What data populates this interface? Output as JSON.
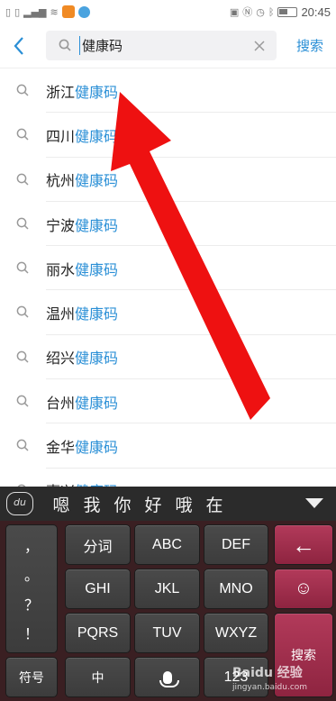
{
  "status_bar": {
    "time": "20:45",
    "left_icons": [
      "sim-icon",
      "sim-icon",
      "signal-icon",
      "signal-icon",
      "wifi-icon",
      "app-icon",
      "app-icon"
    ],
    "right_icons": [
      "vibrate-icon",
      "nfc-icon",
      "alarm-icon",
      "bluetooth-icon",
      "battery-icon"
    ]
  },
  "search": {
    "back_icon": "back-chevron-icon",
    "query": "健康码",
    "clear_icon": "clear-x-icon",
    "submit_label": "搜索"
  },
  "suggestions": [
    {
      "prefix": "浙江",
      "keyword": "健康码"
    },
    {
      "prefix": "四川",
      "keyword": "健康码"
    },
    {
      "prefix": "杭州",
      "keyword": "健康码"
    },
    {
      "prefix": "宁波",
      "keyword": "健康码"
    },
    {
      "prefix": "丽水",
      "keyword": "健康码"
    },
    {
      "prefix": "温州",
      "keyword": "健康码"
    },
    {
      "prefix": "绍兴",
      "keyword": "健康码"
    },
    {
      "prefix": "台州",
      "keyword": "健康码"
    },
    {
      "prefix": "金华",
      "keyword": "健康码"
    },
    {
      "prefix": "嘉兴",
      "keyword": "健康码"
    }
  ],
  "ime": {
    "logo_text": "du",
    "candidates": [
      "嗯",
      "我",
      "你",
      "好",
      "哦",
      "在"
    ],
    "punctuation": [
      "，",
      "。",
      "？",
      "！"
    ],
    "keys": {
      "row1": [
        "分词",
        "ABC",
        "DEF"
      ],
      "row2": [
        "GHI",
        "JKL",
        "MNO"
      ],
      "row3": [
        "PQRS",
        "TUV",
        "WXYZ"
      ],
      "bottom": [
        "符号",
        "中",
        "123"
      ],
      "backspace": "←",
      "emoji": "☺",
      "enter": "搜索"
    }
  },
  "watermark": {
    "brand": "Baidu 经验",
    "url": "jingyan.baidu.com"
  },
  "annotation": {
    "color": "#ee1111"
  }
}
